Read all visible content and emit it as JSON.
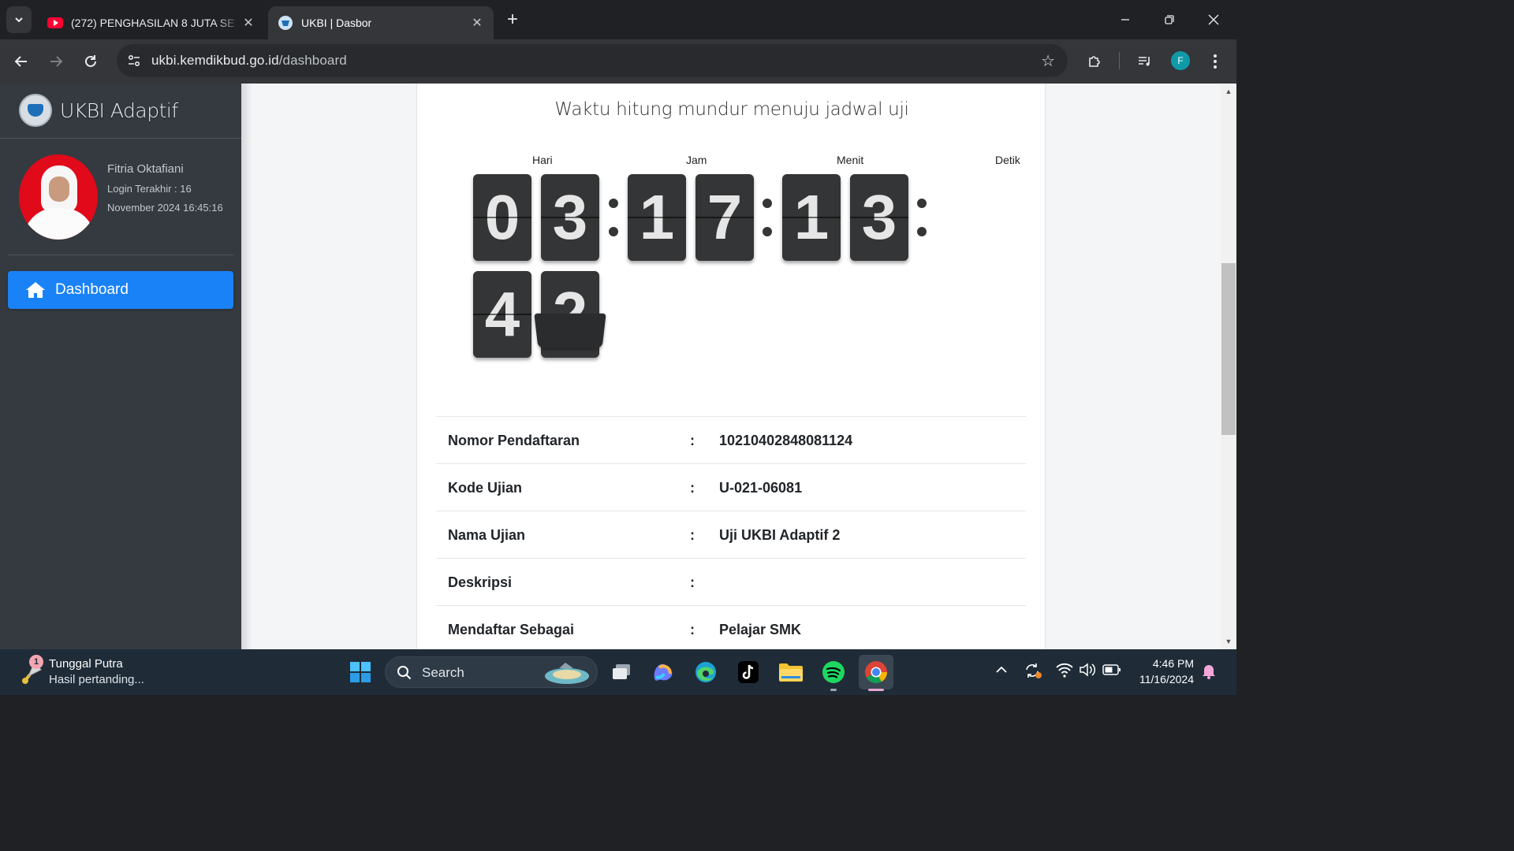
{
  "browser": {
    "tabs": [
      {
        "title": "(272) PENGHASILAN 8 JUTA SE",
        "icon": "youtube-icon",
        "active": false
      },
      {
        "title": "UKBI | Dasbor",
        "icon": "tut-wuri-handayani-icon",
        "active": true
      }
    ],
    "url_domain": "ukbi.kemdikbud.go.id",
    "url_path": "/dashboard",
    "profile_initial": "F"
  },
  "sidebar": {
    "brand": "UKBI Adaptif",
    "user": {
      "name": "Fitria Oktafiani",
      "login_line1": "Login Terakhir : 16",
      "login_line2": "November 2024 16:45:16"
    },
    "nav": [
      {
        "label": "Dashboard",
        "icon": "home-icon",
        "active": true
      }
    ]
  },
  "main": {
    "countdown_title": "Waktu hitung mundur menuju jadwal uji",
    "countdown": {
      "labels": [
        "Hari",
        "Jam",
        "Menit",
        "Detik"
      ],
      "days": [
        "0",
        "3"
      ],
      "hours": [
        "1",
        "7"
      ],
      "minutes": [
        "1",
        "3"
      ],
      "seconds": [
        "4",
        "2"
      ]
    },
    "info": [
      {
        "label": "Nomor Pendaftaran",
        "separator": ":",
        "value": "10210402848081124"
      },
      {
        "label": "Kode Ujian",
        "separator": ":",
        "value": "U-021-06081"
      },
      {
        "label": "Nama Ujian",
        "separator": ":",
        "value": "Uji UKBI Adaptif 2"
      },
      {
        "label": "Deskripsi",
        "separator": ":",
        "value": ""
      },
      {
        "label": "Mendaftar Sebagai",
        "separator": ":",
        "value": "Pelajar SMK"
      }
    ]
  },
  "taskbar": {
    "notification": {
      "badge": "1",
      "title": "Tunggal Putra",
      "subtitle": "Hasil pertanding..."
    },
    "search_label": "Search",
    "time": "4:46 PM",
    "date": "11/16/2024"
  },
  "colors": {
    "accent": "#1a82f7",
    "sidebar": "#343a40",
    "digit": "#343536"
  }
}
